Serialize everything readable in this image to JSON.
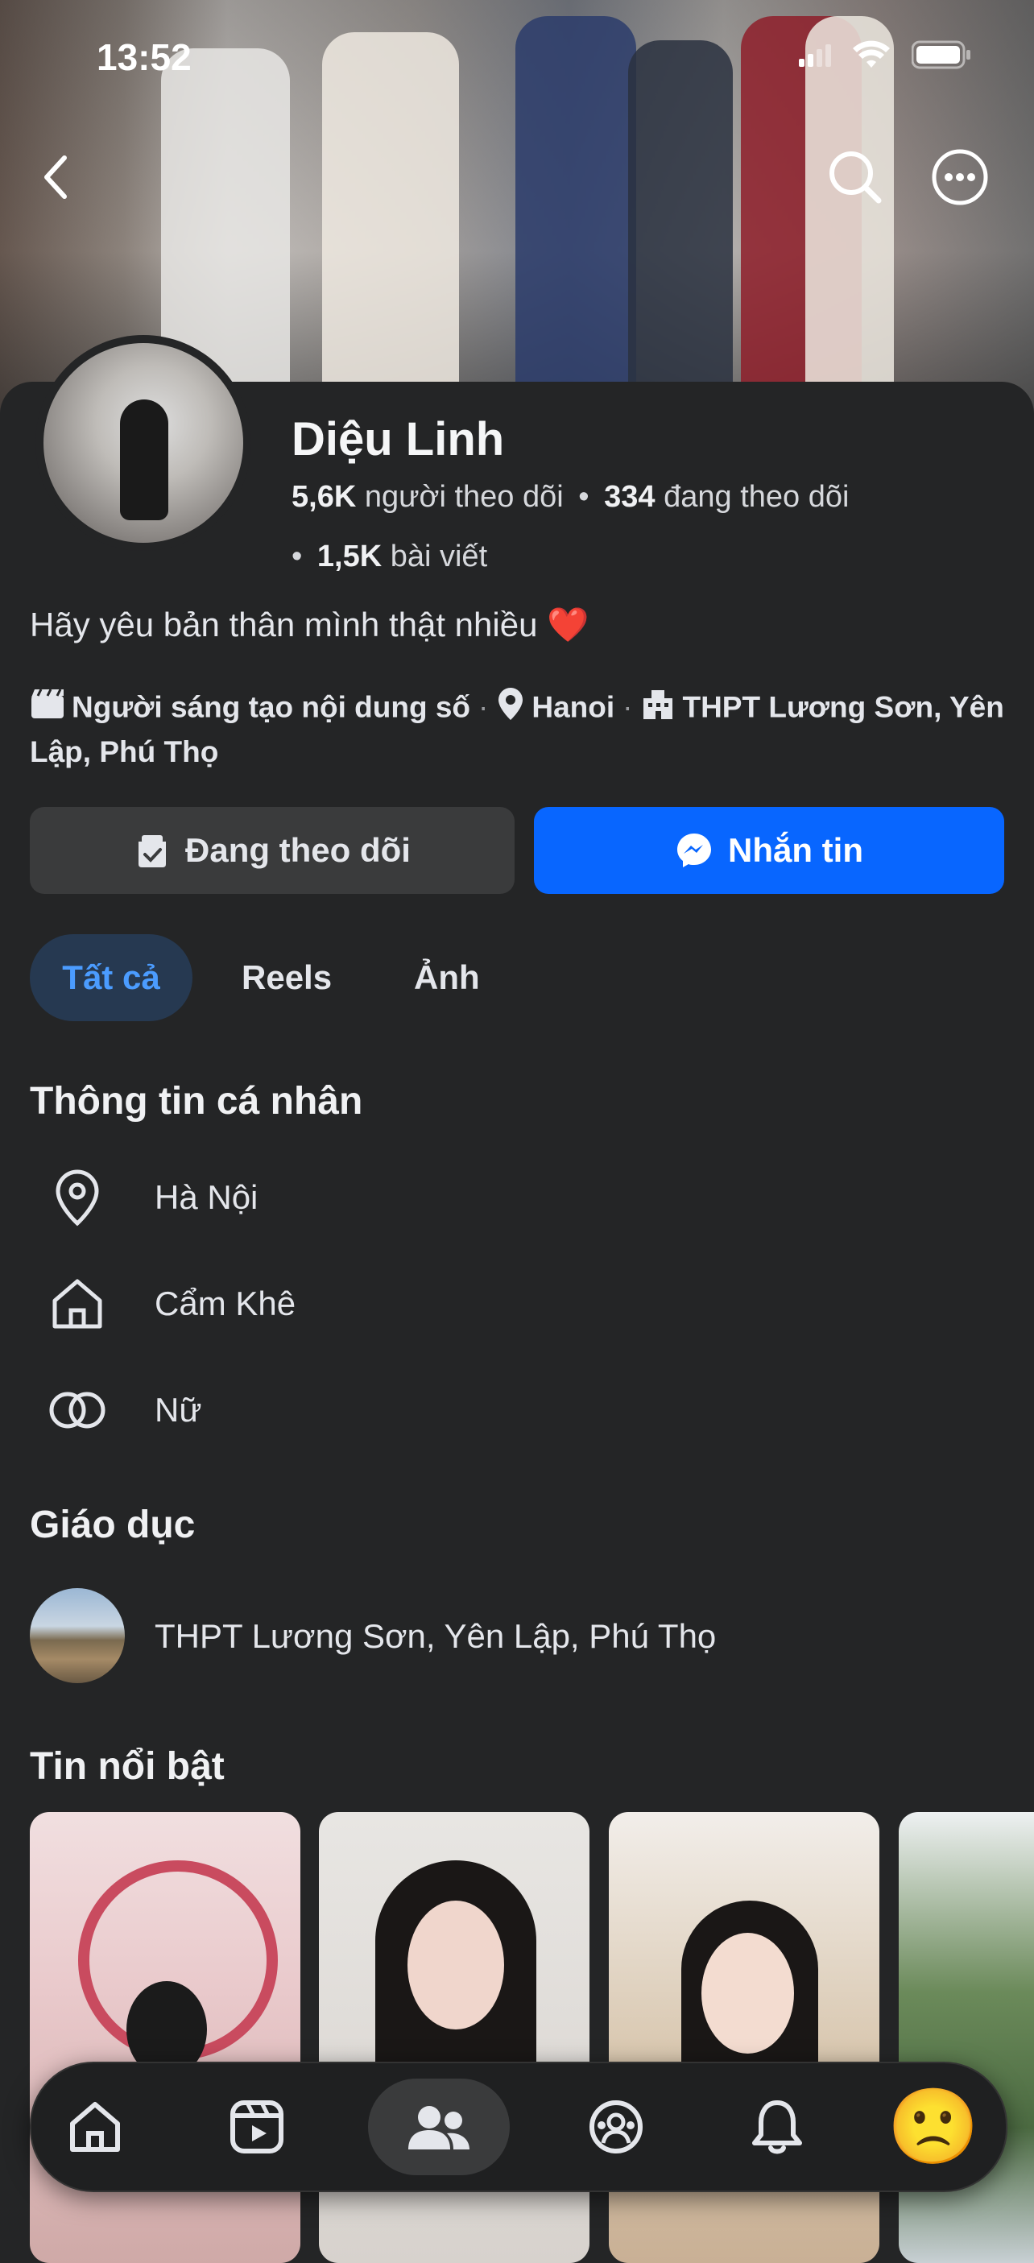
{
  "status_bar": {
    "time": "13:52"
  },
  "profile": {
    "name": "Diệu Linh",
    "followers_count": "5,6K",
    "followers_label": "người theo dõi",
    "following_count": "334",
    "following_label": "đang theo dõi",
    "posts_count": "1,5K",
    "posts_label": "bài viết",
    "bio": "Hãy yêu bản thân mình thật nhiều ❤️",
    "meta": {
      "category": "Người sáng tạo nội dung số",
      "location": "Hanoi",
      "school": "THPT  Lương Sơn, Yên Lập, Phú Thọ"
    }
  },
  "actions": {
    "follow_label": "Đang theo dõi",
    "message_label": "Nhắn tin"
  },
  "tabs": [
    {
      "label": "Tất cả",
      "active": true
    },
    {
      "label": "Reels",
      "active": false
    },
    {
      "label": "Ảnh",
      "active": false
    }
  ],
  "personal_info": {
    "title": "Thông tin cá nhân",
    "items": [
      {
        "icon": "location-pin-icon",
        "text": "Hà Nội"
      },
      {
        "icon": "home-icon",
        "text": "Cẩm Khê"
      },
      {
        "icon": "gender-rings-icon",
        "text": "Nữ"
      }
    ]
  },
  "education": {
    "title": "Giáo dục",
    "school": "THPT  Lương Sơn, Yên Lập, Phú Thọ"
  },
  "highlights": {
    "title": "Tin nổi bật"
  },
  "nav": {
    "items": [
      "home-icon",
      "reels-icon",
      "friends-icon",
      "groups-icon",
      "bell-icon",
      "profile-emoji"
    ],
    "active": "friends-icon",
    "profile_emoji": "🙁"
  },
  "colors": {
    "accent": "#0866ff",
    "background": "#242526",
    "active_tab_text": "#4b9cff"
  }
}
